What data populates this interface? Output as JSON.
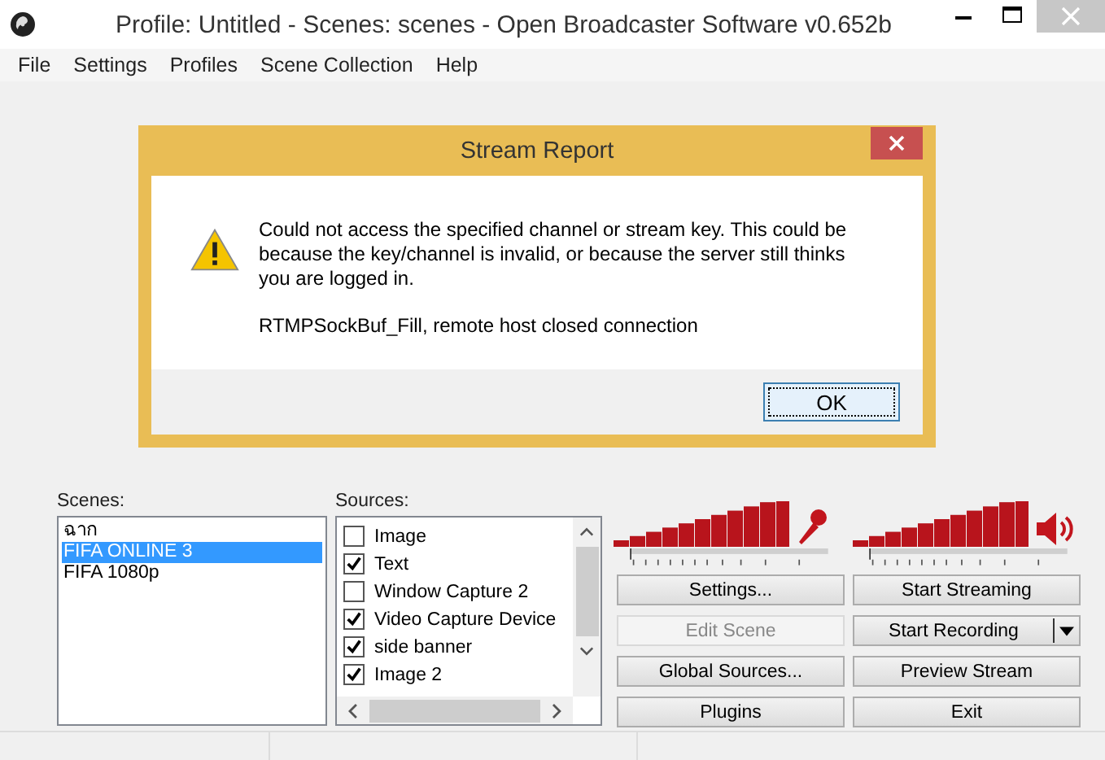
{
  "window": {
    "title": "Profile: Untitled - Scenes: scenes - Open Broadcaster Software v0.652b"
  },
  "menu": [
    "File",
    "Settings",
    "Profiles",
    "Scene Collection",
    "Help"
  ],
  "dialog": {
    "title": "Stream Report",
    "message": "Could not access the specified channel or stream key.  This could be because the key/channel is invalid, or because the server still thinks you are logged in.",
    "detail": "RTMPSockBuf_Fill, remote host closed connection",
    "button": "OK"
  },
  "scenes": {
    "label": "Scenes:",
    "items": [
      {
        "name": "ฉาก",
        "selected": false
      },
      {
        "name": "FIFA ONLINE 3",
        "selected": true
      },
      {
        "name": "FIFA 1080p",
        "selected": false
      }
    ]
  },
  "sources": {
    "label": "Sources:",
    "items": [
      {
        "name": "Image",
        "checked": false
      },
      {
        "name": "Text",
        "checked": true
      },
      {
        "name": "Window Capture 2",
        "checked": false
      },
      {
        "name": "Video Capture Device",
        "checked": true
      },
      {
        "name": "side banner",
        "checked": true
      },
      {
        "name": "Image 2",
        "checked": true
      }
    ]
  },
  "mic_volume": {
    "level": 1
  },
  "desktop_volume": {
    "level": 1
  },
  "buttons": [
    {
      "label": "Settings...",
      "disabled": false,
      "kind": "plain"
    },
    {
      "label": "Start Streaming",
      "disabled": false,
      "kind": "plain"
    },
    {
      "label": "Edit Scene",
      "disabled": true,
      "kind": "plain"
    },
    {
      "label": "Start Recording",
      "disabled": false,
      "kind": "split"
    },
    {
      "label": "Global Sources...",
      "disabled": false,
      "kind": "plain"
    },
    {
      "label": "Preview Stream",
      "disabled": false,
      "kind": "plain"
    },
    {
      "label": "Plugins",
      "disabled": false,
      "kind": "plain"
    },
    {
      "label": "Exit",
      "disabled": false,
      "kind": "plain"
    }
  ]
}
